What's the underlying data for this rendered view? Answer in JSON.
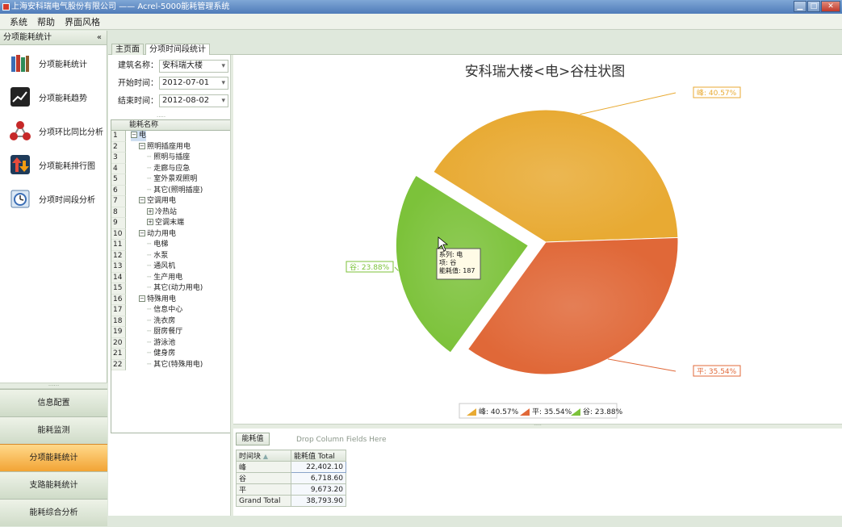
{
  "window": {
    "title": "上海安科瑞电气股份有限公司 —— Acrel-5000能耗管理系统"
  },
  "menu": [
    "系统",
    "帮助",
    "界面风格"
  ],
  "left_panel": {
    "title": "分项能耗统计",
    "collapse_label": "«",
    "nav_items": [
      {
        "label": "分项能耗统计",
        "icon": "books-icon"
      },
      {
        "label": "分项能耗趋势",
        "icon": "trend-chart-icon"
      },
      {
        "label": "分项环比同比分析",
        "icon": "molecule-icon"
      },
      {
        "label": "分项能耗排行图",
        "icon": "ranking-arrows-icon"
      },
      {
        "label": "分项时间段分析",
        "icon": "clock-calendar-icon"
      }
    ],
    "accordion": [
      "信息配置",
      "能耗监测",
      "分项能耗统计",
      "支路能耗统计",
      "能耗综合分析"
    ]
  },
  "tabs": [
    "主页面",
    "分项时间段统计"
  ],
  "form": {
    "building_label": "建筑名称：",
    "building_value": "安科瑞大楼",
    "start_label": "开始时间：",
    "start_value": "2012-07-01",
    "end_label": "结束时间：",
    "end_value": "2012-08-02"
  },
  "tree": {
    "header": "能耗名称",
    "rows": [
      {
        "num": "1",
        "label": "电",
        "level": 0,
        "exp": "−"
      },
      {
        "num": "2",
        "label": "照明插座用电",
        "level": 1,
        "exp": "−"
      },
      {
        "num": "3",
        "label": "照明与插座",
        "level": 2,
        "exp": ""
      },
      {
        "num": "4",
        "label": "走廊与应急",
        "level": 2,
        "exp": ""
      },
      {
        "num": "5",
        "label": "室外景观照明",
        "level": 2,
        "exp": ""
      },
      {
        "num": "6",
        "label": "其它(照明插座)",
        "level": 2,
        "exp": ""
      },
      {
        "num": "7",
        "label": "空调用电",
        "level": 1,
        "exp": "−"
      },
      {
        "num": "8",
        "label": "冷热站",
        "level": 2,
        "exp": "+"
      },
      {
        "num": "9",
        "label": "空调末端",
        "level": 2,
        "exp": "+"
      },
      {
        "num": "10",
        "label": "动力用电",
        "level": 1,
        "exp": "−"
      },
      {
        "num": "11",
        "label": "电梯",
        "level": 2,
        "exp": ""
      },
      {
        "num": "12",
        "label": "水泵",
        "level": 2,
        "exp": ""
      },
      {
        "num": "13",
        "label": "通风机",
        "level": 2,
        "exp": ""
      },
      {
        "num": "14",
        "label": "生产用电",
        "level": 2,
        "exp": ""
      },
      {
        "num": "15",
        "label": "其它(动力用电)",
        "level": 2,
        "exp": ""
      },
      {
        "num": "16",
        "label": "特殊用电",
        "level": 1,
        "exp": "−"
      },
      {
        "num": "17",
        "label": "信息中心",
        "level": 2,
        "exp": ""
      },
      {
        "num": "18",
        "label": "洗衣房",
        "level": 2,
        "exp": ""
      },
      {
        "num": "19",
        "label": "厨房餐厅",
        "level": 2,
        "exp": ""
      },
      {
        "num": "20",
        "label": "游泳池",
        "level": 2,
        "exp": ""
      },
      {
        "num": "21",
        "label": "健身房",
        "level": 2,
        "exp": ""
      },
      {
        "num": "22",
        "label": "其它(特殊用电)",
        "level": 2,
        "exp": ""
      }
    ]
  },
  "chart_data": {
    "type": "pie",
    "title": "安科瑞大楼<电>谷柱状图",
    "slices": [
      {
        "name": "峰",
        "percent": 40.57,
        "label": "峰: 40.57%",
        "legend": "峰: 40.57%",
        "color": "#e8aa33"
      },
      {
        "name": "平",
        "percent": 35.54,
        "label": "平: 35.54%",
        "legend": "平: 35.54%",
        "color": "#e06838"
      },
      {
        "name": "谷",
        "percent": 23.88,
        "label": "谷: 23.88%",
        "legend": "谷: 23.88%",
        "color": "#7cc23a",
        "exploded": true
      }
    ],
    "tooltip": [
      "系列: 电",
      "项: 谷",
      "能耗值: 187"
    ]
  },
  "pivot": {
    "field_button": "能耗值",
    "drop_hint": "Drop Column Fields Here",
    "row_header": "时间块",
    "col_header": "能耗值 Total",
    "rows": [
      {
        "label": "峰",
        "value": "22,402.10"
      },
      {
        "label": "谷",
        "value": "6,718.60"
      },
      {
        "label": "平",
        "value": "9,673.20"
      },
      {
        "label": "Grand Total",
        "value": "38,793.90"
      }
    ]
  }
}
